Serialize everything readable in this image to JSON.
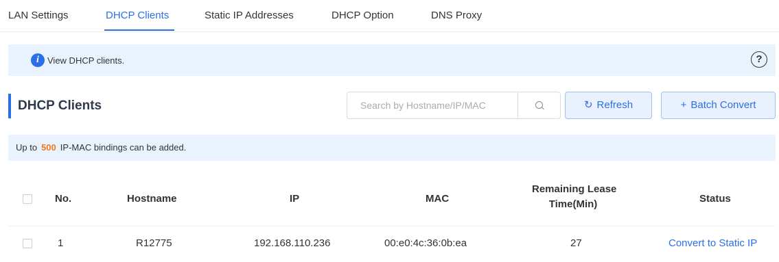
{
  "tabs": [
    {
      "label": "LAN Settings",
      "active": false
    },
    {
      "label": "DHCP Clients",
      "active": true
    },
    {
      "label": "Static IP Addresses",
      "active": false
    },
    {
      "label": "DHCP Option",
      "active": false
    },
    {
      "label": "DNS Proxy",
      "active": false
    }
  ],
  "info": {
    "text": "View DHCP clients.",
    "icon": "info-icon",
    "help_icon": "help-circle-icon",
    "help_glyph": "?"
  },
  "section": {
    "title": "DHCP Clients"
  },
  "search": {
    "placeholder": "Search by Hostname/IP/MAC",
    "value": ""
  },
  "toolbar": {
    "refresh_label": "Refresh",
    "batch_convert_label": "Batch Convert",
    "refresh_icon": "refresh-icon",
    "add_icon": "plus-icon"
  },
  "notice": {
    "prefix": "Up to",
    "limit": "500",
    "suffix": "IP-MAC bindings can be added."
  },
  "table": {
    "headers": {
      "no": "No.",
      "hostname": "Hostname",
      "ip": "IP",
      "mac": "MAC",
      "lease_line1": "Remaining Lease",
      "lease_line2": "Time(Min)",
      "status": "Status"
    },
    "rows": [
      {
        "no": "1",
        "hostname": "R12775",
        "ip": "192.168.110.236",
        "mac": "00:e0:4c:36:0b:ea",
        "lease": "27",
        "status": "Convert to Static IP"
      }
    ]
  },
  "colors": {
    "accent": "#2b6fe6",
    "info_bg": "#e8f3fe",
    "highlight": "#f07a1f"
  }
}
